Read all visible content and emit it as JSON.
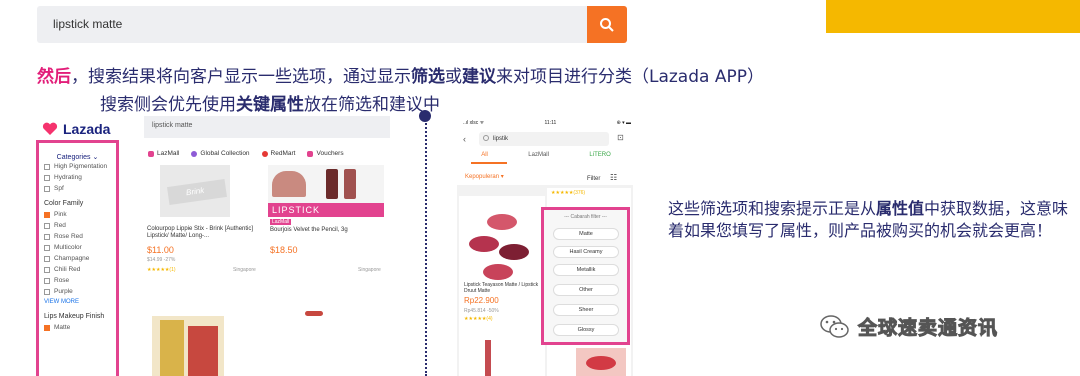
{
  "top_search": {
    "value": "lipstick matte"
  },
  "headline": {
    "lead": "然后",
    "p1": "，搜索结果将向客户显示一些选项，通过显示",
    "b1": "筛选",
    "p2": "或",
    "b2": "建议",
    "p3": "来对项目进行分类（Lazada APP）"
  },
  "headline2": {
    "p1": "搜索侧会优先使用",
    "b1": "关键属性",
    "p2": "放在筛选和建议中"
  },
  "desktop": {
    "logo": "Lazada",
    "search_value": "lipstick matte",
    "sidebar": {
      "categories_label": "Categories",
      "top_options": [
        "High Pigmentation",
        "Hydrating",
        "Spf"
      ],
      "color_family_title": "Color Family",
      "color_options": [
        {
          "label": "Pink",
          "checked": true
        },
        {
          "label": "Red",
          "checked": false
        },
        {
          "label": "Rose Red",
          "checked": false
        },
        {
          "label": "Multicolor",
          "checked": false
        },
        {
          "label": "Champagne",
          "checked": false
        },
        {
          "label": "Chili Red",
          "checked": false
        },
        {
          "label": "Rose",
          "checked": false
        },
        {
          "label": "Purple",
          "checked": false
        }
      ],
      "view_more": "VIEW MORE",
      "finish_title": "Lips Makeup Finish",
      "finish_option": "Matte"
    },
    "tabs": [
      {
        "label": "LazMall",
        "color": "#e2438f"
      },
      {
        "label": "Global Collection",
        "color": "#8e5bd6"
      },
      {
        "label": "RedMart",
        "color": "#e53935"
      },
      {
        "label": "Vouchers",
        "color": "#e2438f"
      }
    ],
    "product1": {
      "brand": "Brink",
      "title": "Colourpop Lippie Stix - Brink [Authentic] Lipstick/ Matte/ Long-...",
      "price": "$11.00",
      "sub": "$14.99 -27%",
      "rating": "★★★★★(1)",
      "location": "Singapore"
    },
    "product2": {
      "banner": "LIPSTICK",
      "tag": "LazMall",
      "title": "Bourjois Velvet the Pencil, 3g",
      "price": "$18.50",
      "location": "Singapore"
    }
  },
  "phone": {
    "status_left": "..ıl xlsc ᯤ",
    "status_time": "11:11",
    "status_right": "⊕ ▾ ▬",
    "search_value": "lipstik",
    "tabs": [
      "All",
      "LazMall",
      "LiTERO"
    ],
    "sort_label": "Kepopuleran ▾",
    "filter_label": "Filter",
    "card1": {
      "title": "Lipstick Teayason Matte / Lipstick Druut Matte",
      "price": "Rp22.900",
      "sub": "Rp45.814 -50%",
      "rating": "★★★★★(4)"
    },
    "card2": {
      "rating": "★★★★★(376)"
    },
    "filter_header": "--- Cabarah filter ---",
    "filter_chips": [
      "Matte",
      "Hasil Creamy",
      "Metallik",
      "Other",
      "Sheer",
      "Glossy"
    ]
  },
  "description": {
    "p1": "这些筛选项和搜索提示正是从",
    "b1": "属性值",
    "p2": "中获取数据，这意味着如果您填写了属性，则产品被购买的机会就会更高！"
  },
  "watermark": {
    "text": "全球速卖通资讯"
  }
}
